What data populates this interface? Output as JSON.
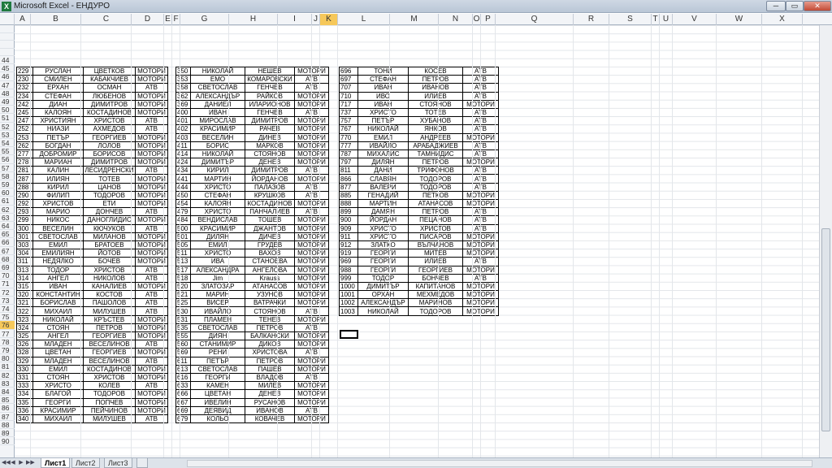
{
  "window": {
    "title": "Microsoft Excel - ЕНДУРО",
    "min": "─",
    "max": "▭",
    "close": "✕",
    "icon": "X"
  },
  "columns": [
    "A",
    "B",
    "C",
    "D",
    "E",
    "F",
    "G",
    "H",
    "I",
    "J",
    "K",
    "L",
    "M",
    "N",
    "O",
    "P",
    "Q",
    "R",
    "S",
    "T",
    "U",
    "V",
    "W",
    "X"
  ],
  "active_column": "K",
  "rows": [
    "44",
    "45",
    "46",
    "47",
    "48",
    "49",
    "50",
    "51",
    "52",
    "53",
    "54",
    "55",
    "56",
    "57",
    "58",
    "59",
    "60",
    "61",
    "62",
    "63",
    "64",
    "65",
    "66",
    "67",
    "68",
    "69",
    "70",
    "71",
    "72",
    "73",
    "74",
    "75",
    "76",
    "77",
    "78",
    "79",
    "80",
    "81",
    "82",
    "83",
    "84",
    "85",
    "86",
    "87",
    "88",
    "89",
    "90"
  ],
  "active_row": "76",
  "table1": [
    [
      "229",
      "РУСЛАН",
      "ЦВЕТКОВ",
      "МОТОРИ"
    ],
    [
      "230",
      "СМИЛЕН",
      "КАБАКЧИЕВ",
      "МОТОРИ"
    ],
    [
      "232",
      "ЕРХАН",
      "ОСМАН",
      "АТВ"
    ],
    [
      "234",
      "СТЕФАН",
      "ЛЮБЕНОВ",
      "МОТОРИ"
    ],
    [
      "242",
      "ДИАН",
      "ДИМИТРОВ",
      "МОТОРИ"
    ],
    [
      "245",
      "КАЛОЯН",
      "КОСТАДИНОВ",
      "МОТОРИ"
    ],
    [
      "247",
      "ХРИСТИЯН",
      "ХРИСТОВ",
      "АТВ"
    ],
    [
      "252",
      "НИАЗИ",
      "АХМЕДОВ",
      "АТВ"
    ],
    [
      "253",
      "ПЕТЪР",
      "ГЕОРГИЕВ",
      "МОТОРИ"
    ],
    [
      "262",
      "БОГДАН",
      "ЛОЛОВ",
      "МОТОРИ"
    ],
    [
      "277",
      "ДОБРОМИР",
      "БОРИСОВ",
      "МОТОРИ"
    ],
    [
      "278",
      "МАРИАН",
      "ДИМИТРОВ",
      "МОТОРИ"
    ],
    [
      "281",
      "КАЛИН",
      "ЛЕСИДРЕНСКИ",
      "АТВ"
    ],
    [
      "287",
      "ИЛИЯН",
      "ТОТЕВ",
      "МОТОРИ"
    ],
    [
      "288",
      "КИРИЛ",
      "ЦАНОВ",
      "МОТОРИ"
    ],
    [
      "290",
      "ФИЛИП",
      "ТОДОРОВ",
      "МОТОРИ"
    ],
    [
      "292",
      "ХРИСТОВ",
      "ЕТИ",
      "МОТОРИ"
    ],
    [
      "293",
      "МАРИО",
      "ДОНЧЕВ",
      "АТВ"
    ],
    [
      "299",
      "НИКОС",
      "ДАНОГЛИДИС",
      "МОТОРИ"
    ],
    [
      "300",
      "ВЕСЕЛИН",
      "КЮЧУКОВ",
      "АТВ"
    ],
    [
      "301",
      "СВЕТОСЛАВ",
      "МИЛАНОВ",
      "МОТОРИ"
    ],
    [
      "303",
      "ЕМИЛ",
      "БРАТОЕВ",
      "МОТОРИ"
    ],
    [
      "304",
      "ЕМИЛИЯН",
      "ЙОТОВ",
      "МОТОРИ"
    ],
    [
      "311",
      "НЕДЯЛКО",
      "БОЧЕВ",
      "МОТОРИ"
    ],
    [
      "313",
      "ТОДОР",
      "ХРИСТОВ",
      "АТВ"
    ],
    [
      "314",
      "АНГЕЛ",
      "НИКОЛОВ",
      "АТВ"
    ],
    [
      "315",
      "ИВАН",
      "КАНАЛИЕВ",
      "МОТОРИ"
    ],
    [
      "320",
      "КОНСТАНТИН",
      "КОСТОВ",
      "АТВ"
    ],
    [
      "321",
      "БОРИСЛАВ",
      "ПАШОЛОВ",
      "АТВ"
    ],
    [
      "322",
      "МИХАИЛ",
      "МИЛУШЕВ",
      "АТВ"
    ],
    [
      "323",
      "НИКОЛАЙ",
      "КРЪСТЕВ",
      "МОТОРИ"
    ],
    [
      "324",
      "СТОЯН",
      "ПЕТРОВ",
      "МОТОРИ"
    ],
    [
      "325",
      "АНГЕЛ",
      "ГЕОРГИЕВ",
      "МОТОРИ"
    ],
    [
      "326",
      "МЛАДЕН",
      "ВЕСЕЛИНОВ",
      "АТВ"
    ],
    [
      "328",
      "ЦВЕТАН",
      "ГЕОРГИЕВ",
      "МОТОРИ"
    ],
    [
      "329",
      "МЛАДЕН",
      "ВЕСЕЛИНОВ",
      "АТВ"
    ],
    [
      "330",
      "ЕМИЛ",
      "КОСТАДИНОВ",
      "МОТОРИ"
    ],
    [
      "331",
      "СТОЯН",
      "ХРИСТОВ",
      "МОТОРИ"
    ],
    [
      "333",
      "ХРИСТО",
      "КОЛЕВ",
      "АТВ"
    ],
    [
      "334",
      "БЛАГОЙ",
      "ТОДОРОВ",
      "МОТОРИ"
    ],
    [
      "335",
      "ГЕОРГИ",
      "ПОПЧЕВ",
      "МОТОРИ"
    ],
    [
      "336",
      "КРАСИМИР",
      "ПЕЙЧИНОВ",
      "МОТОРИ"
    ],
    [
      "340",
      "МИХАИЛ",
      "МИЛУШЕВ",
      "АТВ"
    ]
  ],
  "table2": [
    [
      "350",
      "НИКОЛАЙ",
      "НЕШЕВ",
      "МОТОРИ"
    ],
    [
      "353",
      "ЕМО",
      "КОМАРОВСКИ",
      "АТВ"
    ],
    [
      "358",
      "СВЕТОСЛАВ",
      "ГЕНЧЕВ",
      "АТВ"
    ],
    [
      "362",
      "АЛЕКСАНДЪР",
      "РАЙКОВ",
      "МОТОРИ"
    ],
    [
      "369",
      "ДАНИЕЛ",
      "ИЛАРИОНОВ",
      "МОТОРИ"
    ],
    [
      "400",
      "ИВАН",
      "ГЕНЧЕВ",
      "АТВ"
    ],
    [
      "401",
      "МИРОСЛАВ",
      "ДИМИТРОВ",
      "МОТОРИ"
    ],
    [
      "402",
      "КРАСИМИР",
      "РАЧЕВ",
      "МОТОРИ"
    ],
    [
      "403",
      "ВЕСЕЛИН",
      "ДИНЕВ",
      "МОТОРИ"
    ],
    [
      "411",
      "БОРИС",
      "МАРКОВ",
      "МОТОРИ"
    ],
    [
      "414",
      "НИКОЛАЙ",
      "СТОЯНОВ",
      "МОТОРИ"
    ],
    [
      "424",
      "ДИМИТЪР",
      "ДЕНЕВ",
      "МОТОРИ"
    ],
    [
      "434",
      "КИРИЛ",
      "ДИМИТРОВ",
      "АТВ"
    ],
    [
      "441",
      "МАРТИН",
      "ЙОРДАНОВ",
      "МОТОРИ"
    ],
    [
      "444",
      "ХРИСТО",
      "ПАЛАЗОВ",
      "АТВ"
    ],
    [
      "450",
      "СТЕФАН",
      "КРУШКОВ",
      "АТВ"
    ],
    [
      "454",
      "КАЛОЯН",
      "КОСТАДИНОВ",
      "МОТОРИ"
    ],
    [
      "479",
      "ХРИСТО",
      "ПАНЧАЛИЕВ",
      "АТВ"
    ],
    [
      "484",
      "ВЕНДИСЛАВ",
      "ТОШЕВ",
      "МОТОРИ"
    ],
    [
      "500",
      "КРАСИМИР",
      "ДЖАНТОВ",
      "МОТОРИ"
    ],
    [
      "501",
      "ДИЛЯН",
      "ДИЧЕВ",
      "МОТОРИ"
    ],
    [
      "505",
      "ЕМИЛ",
      "ГРУДЕВ",
      "МОТОРИ"
    ],
    [
      "511",
      "ХРИСТО",
      "ВАХОВ",
      "МОТОРИ"
    ],
    [
      "513",
      "ИВА",
      "СТАНОЕВА",
      "МОТОРИ"
    ],
    [
      "517",
      "АЛЕКСАНДРА",
      "АНГЕЛОВА",
      "МОТОРИ"
    ],
    [
      "518",
      "Jim",
      "Krauss",
      "МОТОРИ"
    ],
    [
      "520",
      "ЗЛАТОЗАР",
      "АТАНАСОВ",
      "МОТОРИ"
    ],
    [
      "521",
      "МАРИН",
      "УЗУНОВ",
      "МОТОРИ"
    ],
    [
      "525",
      "ВИСЕР",
      "ВАТРАЧКИ",
      "МОТОРИ"
    ],
    [
      "530",
      "ИВАЙЛО",
      "СТОЯНОВ",
      "АТВ"
    ],
    [
      "531",
      "ПЛАМЕН",
      "ТЕНЕВ",
      "МОТОРИ"
    ],
    [
      "535",
      "СВЕТОСЛАВ",
      "ПЕТРОВ",
      "АТВ"
    ],
    [
      "555",
      "ДИЯН",
      "БАЛКАНСКИ",
      "МОТОРИ"
    ],
    [
      "560",
      "СТАНИМИР",
      "ДИКОВ",
      "МОТОРИ"
    ],
    [
      "569",
      "РЕНИ",
      "ХРИСТОВА",
      "АТВ"
    ],
    [
      "611",
      "ПЕТЪР",
      "ПЕТРОВ",
      "МОТОРИ"
    ],
    [
      "613",
      "СВЕТОСЛАВ",
      "ПАШЕВ",
      "МОТОРИ"
    ],
    [
      "616",
      "ГЕОРГИ",
      "ВЛАДОВ",
      "АТВ"
    ],
    [
      "633",
      "КАМЕН",
      "МИЛЕВ",
      "МОТОРИ"
    ],
    [
      "666",
      "ЦВЕТАН",
      "ДЕНЕВ",
      "МОТОРИ"
    ],
    [
      "667",
      "ИВЕЛИН",
      "РУСАНОВ",
      "МОТОРИ"
    ],
    [
      "669",
      "ДЕЯВИД",
      "ИВАНОВ",
      "АТВ"
    ],
    [
      "679",
      "КОЛЬО",
      "КОВАЧЕВ",
      "МОТОРИ"
    ]
  ],
  "table3": [
    [
      "696",
      "ТОНИ",
      "КОСЕВ",
      "АТВ"
    ],
    [
      "697",
      "СТЕФАН",
      "ПЕТРОВ",
      "АТВ"
    ],
    [
      "707",
      "ИВАН",
      "ИВАНОВ",
      "АТВ"
    ],
    [
      "710",
      "ИВО",
      "ИЛИЕВ",
      "АТВ"
    ],
    [
      "717",
      "ИВАН",
      "СТОЯНОВ",
      "МОТОРИ"
    ],
    [
      "737",
      "ХРИСТО",
      "ТОТЕВ",
      "АТВ"
    ],
    [
      "757",
      "ПЕТЪР",
      "ХУБАНОВ",
      "АТВ"
    ],
    [
      "767",
      "НИКОЛАЙ",
      "ЯНКОВ",
      "АТВ"
    ],
    [
      "770",
      "ЕМИЛ",
      "АНДРЕЕВ",
      "МОТОРИ"
    ],
    [
      "777",
      "ИВАЙЛО",
      "АРАБАДЖИЕВ",
      "АТВ"
    ],
    [
      "787",
      "МИХАЛИС",
      "ТАМНИДИС",
      "АТВ"
    ],
    [
      "797",
      "ДИЛЯН",
      "ПЕТРОВ",
      "МОТОРИ"
    ],
    [
      "811",
      "ДАНИ",
      "ТРИФОНОВ",
      "АТВ"
    ],
    [
      "866",
      "СЛАВЯН",
      "ТОДОРОВ",
      "АТВ"
    ],
    [
      "877",
      "ВАЛЕРИ",
      "ТОДОРОВ",
      "АТВ"
    ],
    [
      "885",
      "ГЕНАДИЙ",
      "ПЕТКОВ",
      "МОТОРИ"
    ],
    [
      "888",
      "МАРТИН",
      "АТАНАСОВ",
      "МОТОРИ"
    ],
    [
      "899",
      "ДАМЯН",
      "ПЕТРОВ",
      "АТВ"
    ],
    [
      "900",
      "ЙОРДАН",
      "ПЕЦАНОВ",
      "АТВ"
    ],
    [
      "909",
      "ХРИСТО",
      "ХРИСТОВ",
      "АТВ"
    ],
    [
      "911",
      "ХРИСТО",
      "ПИСАРОВ",
      "МОТОРИ"
    ],
    [
      "912",
      "ЗЛАТКО",
      "ВЪЛЧАНОВ",
      "МОТОРИ"
    ],
    [
      "919",
      "ГЕОРГИ",
      "МИТЕВ",
      "МОТОРИ"
    ],
    [
      "969",
      "ГЕОРГИ",
      "ИЛИЕВ",
      "АТВ"
    ],
    [
      "988",
      "ГЕОРГИ",
      "ГЕОРГИЕВ",
      "МОТОРИ"
    ],
    [
      "999",
      "ТОДОР",
      "БОНЧЕВ",
      "АТВ"
    ],
    [
      "1000",
      "ДИМИТЪР",
      "КАПИТАНОВ",
      "МОТОРИ"
    ],
    [
      "1001",
      "ОРХАН",
      "МЕХМЕДОВ",
      "МОТОРИ"
    ],
    [
      "1002",
      "АЛЕКСАНДЪР",
      "МАРИНОВ",
      "МОТОРИ"
    ],
    [
      "1003",
      "НИКОЛАЙ",
      "ТОДОРОВ",
      "МОТОРИ"
    ]
  ],
  "sheets": [
    "Лист1",
    "Лист2",
    "Лист3"
  ],
  "active_sheet": "Лист1",
  "nav": [
    "◀◀",
    "◀",
    "▶",
    "▶▶"
  ]
}
